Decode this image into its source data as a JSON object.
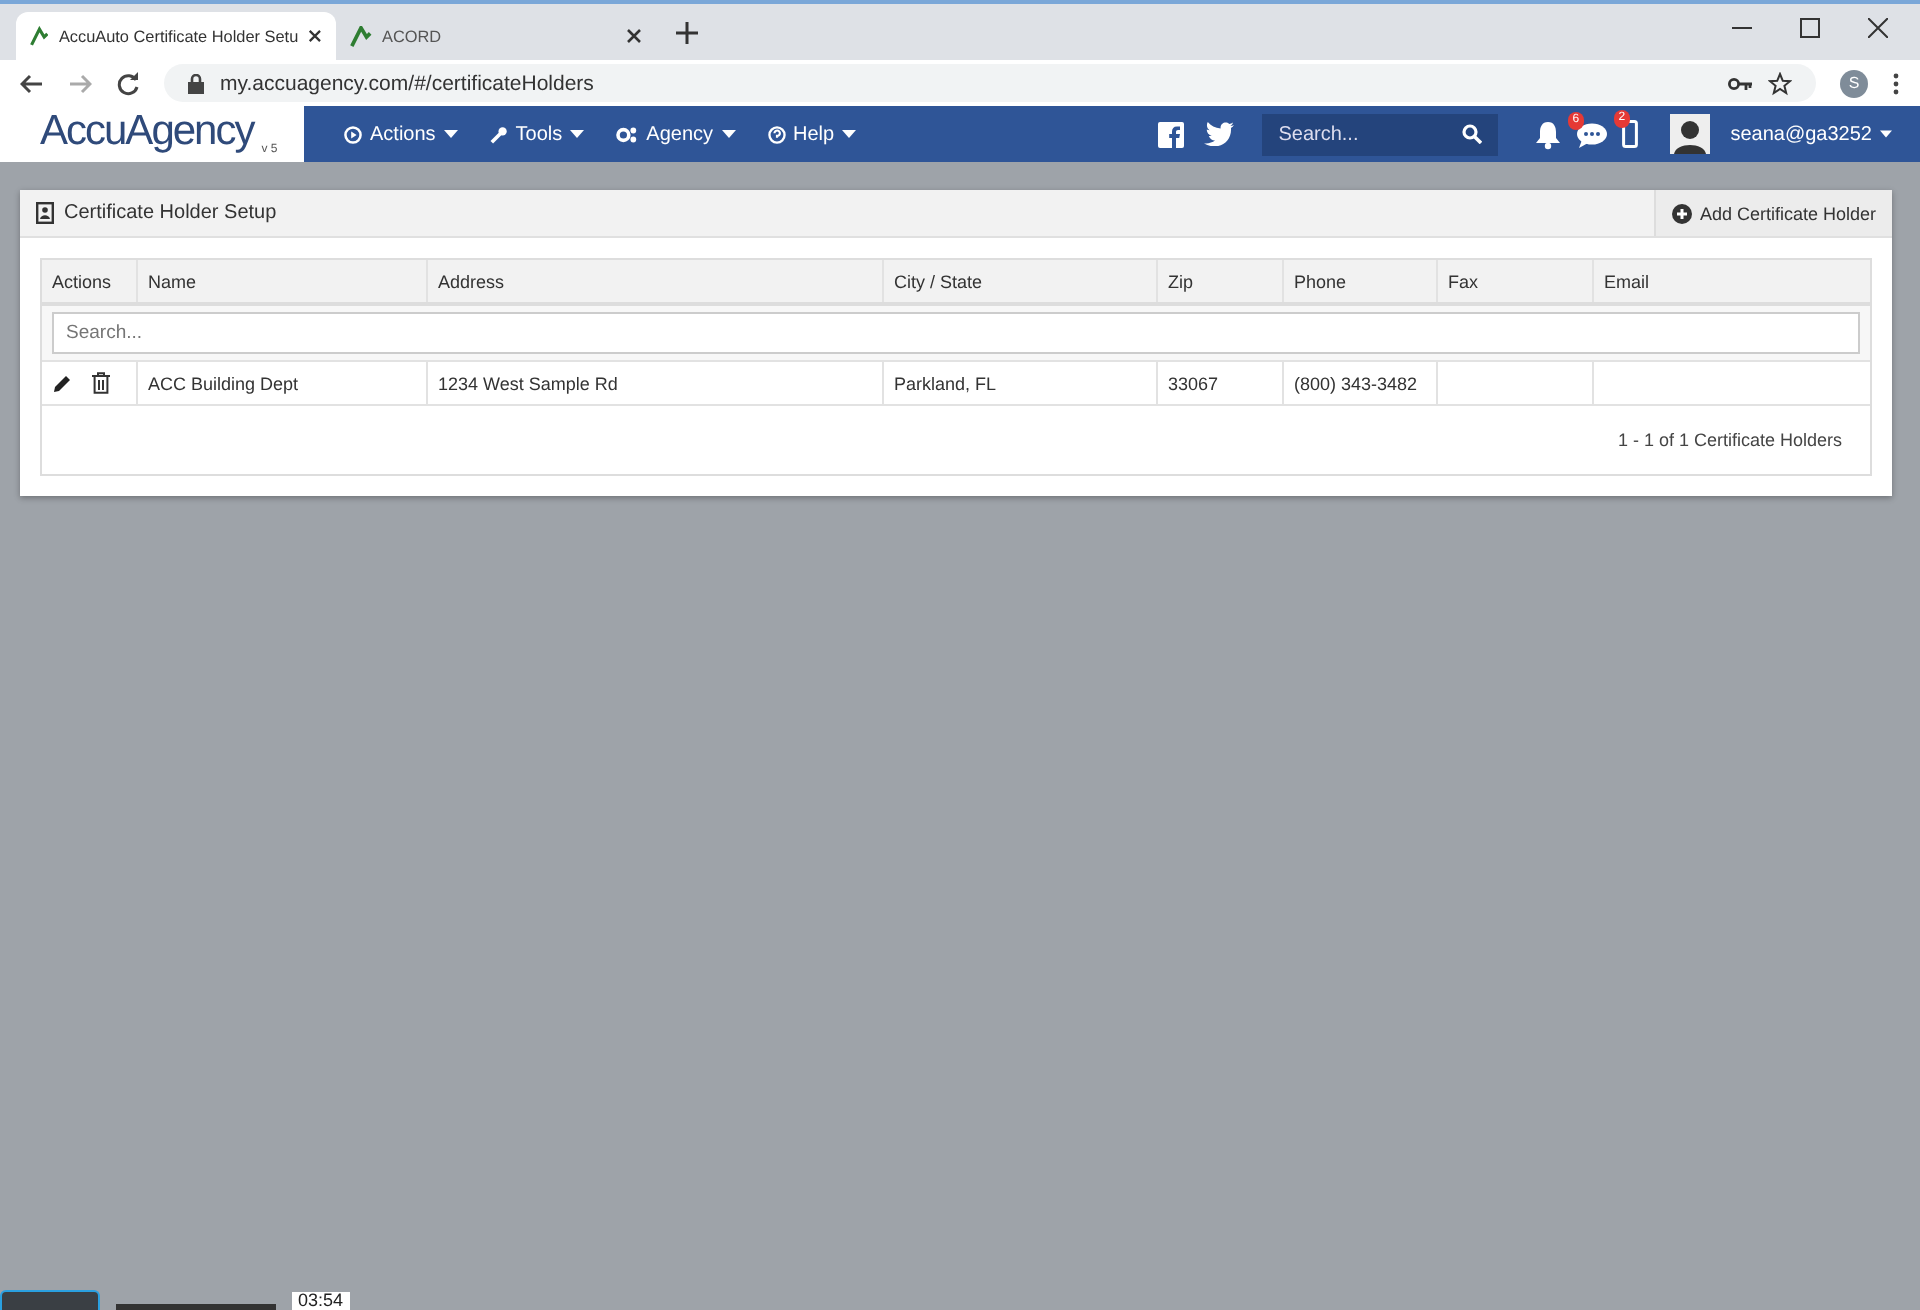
{
  "browser": {
    "tabs": [
      {
        "title": "AccuAuto Certificate Holder Setu",
        "selected": true
      },
      {
        "title": "ACORD",
        "selected": false
      }
    ],
    "url": "my.accuagency.com/#/certificateHolders",
    "profile": "S"
  },
  "navbar": {
    "logo": "AccuAgency",
    "version": "v 5",
    "menu": [
      {
        "label": "Actions"
      },
      {
        "label": "Tools"
      },
      {
        "label": "Agency"
      },
      {
        "label": "Help"
      }
    ],
    "search": {
      "placeholder": "Search..."
    },
    "alerts": [
      {
        "kind": "bell"
      },
      {
        "kind": "chat",
        "badge": "6"
      },
      {
        "kind": "phone",
        "badge": "2"
      }
    ],
    "user": "seana@ga3252"
  },
  "panel": {
    "title": "Certificate Holder Setup",
    "add_button": "Add Certificate Holder",
    "columns": [
      "Actions",
      "Name",
      "Address",
      "City / State",
      "Zip",
      "Phone",
      "Fax",
      "Email"
    ],
    "search": {
      "placeholder": "Search..."
    },
    "rows": [
      {
        "name": "ACC Building Dept",
        "address": "1234 West Sample Rd",
        "city_state": "Parkland, FL",
        "zip": "33067",
        "phone": "(800) 343-3482"
      }
    ],
    "footer": "1 - 1 of 1 Certificate Holders"
  },
  "player": {
    "time": "03:54"
  }
}
